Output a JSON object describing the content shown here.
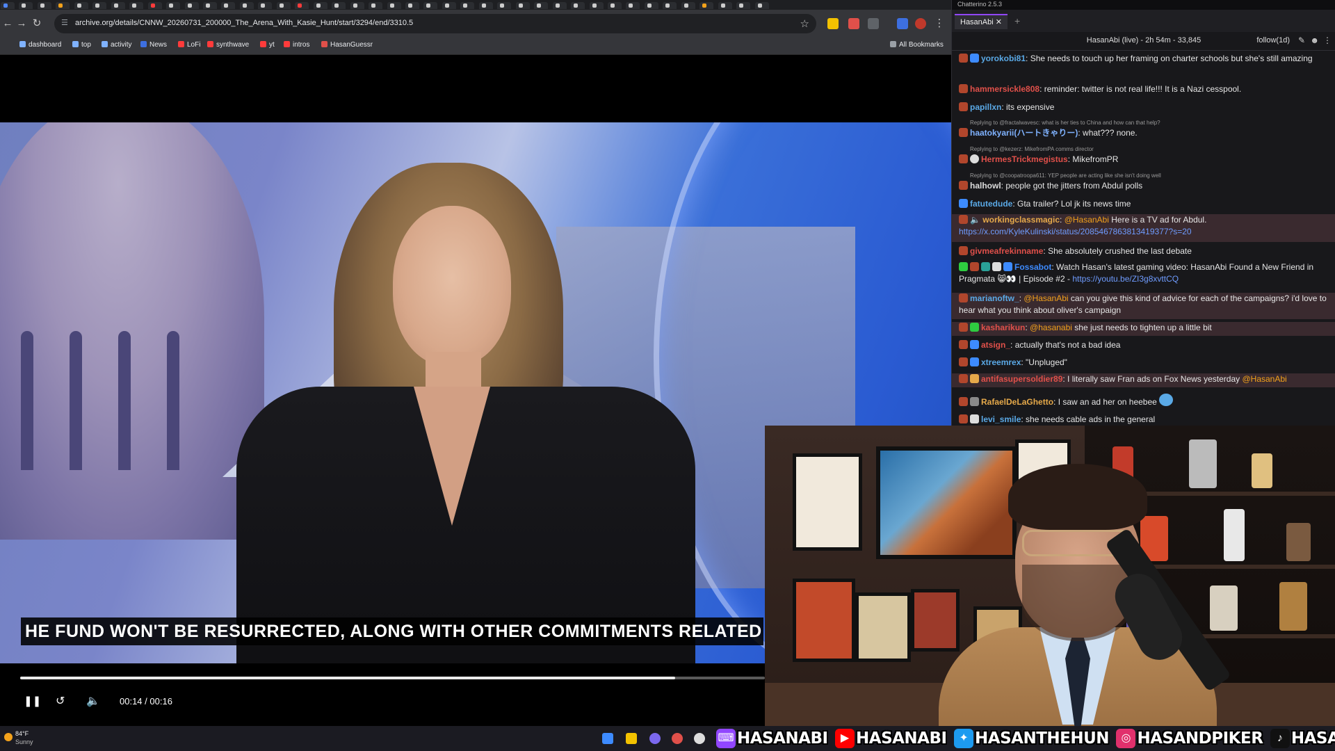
{
  "browser": {
    "url": "archive.org/details/CNNW_20260731_200000_The_Arena_With_Kasie_Hunt/start/3294/end/3310.5",
    "bookmarks": [
      "dashboard",
      "top",
      "activity",
      "News",
      "LoFi",
      "synthwave",
      "yt",
      "intros",
      "HasanGuessr"
    ],
    "all_bookmarks": "All Bookmarks"
  },
  "video": {
    "caption": "HE FUND WON'T BE RESURRECTED, ALONG WITH OTHER COMMITMENTS RELATED",
    "current_time": "00:14",
    "time_separator": "/",
    "duration": "00:16",
    "progress": 0.88
  },
  "taskbar": {
    "temperature": "84°F",
    "condition": "Sunny"
  },
  "socials": [
    {
      "platform": "twitch",
      "name": "HASANABI",
      "color": "#9146ff"
    },
    {
      "platform": "youtube",
      "name": "HASANABI",
      "color": "#ff0000"
    },
    {
      "platform": "twitter",
      "name": "HASANTHEHUN",
      "color": "#1d9bf0"
    },
    {
      "platform": "instagram",
      "name": "HASANDPIKER",
      "color": "#e1306c"
    },
    {
      "platform": "tiktok",
      "name": "HASANDPIKER",
      "color": "#111111"
    }
  ],
  "chat": {
    "app_title": "Chatterino 2.5.3",
    "tab_label": "HasanAbi",
    "stream_info": "HasanAbi (live) - 2h 54m - 33,845",
    "follow_label": "follow(1d)",
    "messages": [
      {
        "user": "yorokobi81",
        "color": "#5aa9e6",
        "text": "She needs to touch up her framing on charter schools but she's still amazing"
      },
      {
        "user": "hammersickle808",
        "color": "#e0504a",
        "text": "reminder: twitter is not real life!!! It is a Nazi cesspool."
      },
      {
        "user": "papillxn",
        "color": "#5aa9e6",
        "text": "its expensive"
      },
      {
        "reply_to": "Replying to @fractalwavesc: what is her ties to China and how can that help?",
        "user": "haatokyarii(ハートきゃりー)",
        "color": "#7fb2ff",
        "text": "what??? none."
      },
      {
        "reply_to": "Replying to @kezerz: MikefromPA comms director",
        "user": "HermesTrickmegistus",
        "color": "#e0504a",
        "text": "MikefromPR"
      },
      {
        "reply_to": "Replying to @coopatroopa611: YEP people are acting like she isn't doing well",
        "user": "halhowl",
        "color": "#dddddd",
        "text": "people got the jitters from Abdul polls"
      },
      {
        "user": "fatutedude",
        "color": "#5aa9e6",
        "text": "Gta trailer? Lol jk its news time"
      },
      {
        "user": "workingclassmagic",
        "color": "#e6a94a",
        "mention": "@HasanAbi",
        "text": "Here is a TV ad for Abdul.",
        "link": "https://x.com/KyleKulinski/status/2085467863813419377?s=20",
        "highlight": true
      },
      {
        "user": "givmeafrekinname",
        "color": "#e0504a",
        "text": "She absolutely crushed the last debate"
      },
      {
        "user": "Fossabot",
        "color": "#3d8bff",
        "text": "Watch Hasan's latest gaming video: HasanAbi Found a New Friend in Pragmata 😸👀 | Episode #2 -",
        "link": "https://youtu.be/ZI3g8xvttCQ"
      },
      {
        "user": "marianoftw_",
        "color": "#5aa9e6",
        "mention": "@HasanAbi",
        "text": "can you give this kind of advice for each of the campaigns? i'd love to hear what you think about oliver's campaign",
        "highlight": true
      },
      {
        "user": "kasharikun",
        "color": "#e0504a",
        "mention": "@hasanabi",
        "text": "she just needs to tighten up a little bit",
        "highlight": true
      },
      {
        "user": "atsign_",
        "color": "#e0504a",
        "text": "actually that's not a bad idea"
      },
      {
        "user": "xtreemrex",
        "color": "#5aa9e6",
        "text": "\"Unpluged\""
      },
      {
        "user": "antifasupersoldier89",
        "color": "#e0504a",
        "text": "I literally saw Fran ads on Fox News yesterday",
        "mention_end": "@HasanAbi",
        "highlight": true
      },
      {
        "user": "RafaelDeLaGhetto",
        "color": "#e6a94a",
        "text": "I saw an ad her on heebee"
      },
      {
        "user": "levi_smile",
        "color": "#5aa9e6",
        "text": "she needs cable ads in the general"
      }
    ]
  }
}
